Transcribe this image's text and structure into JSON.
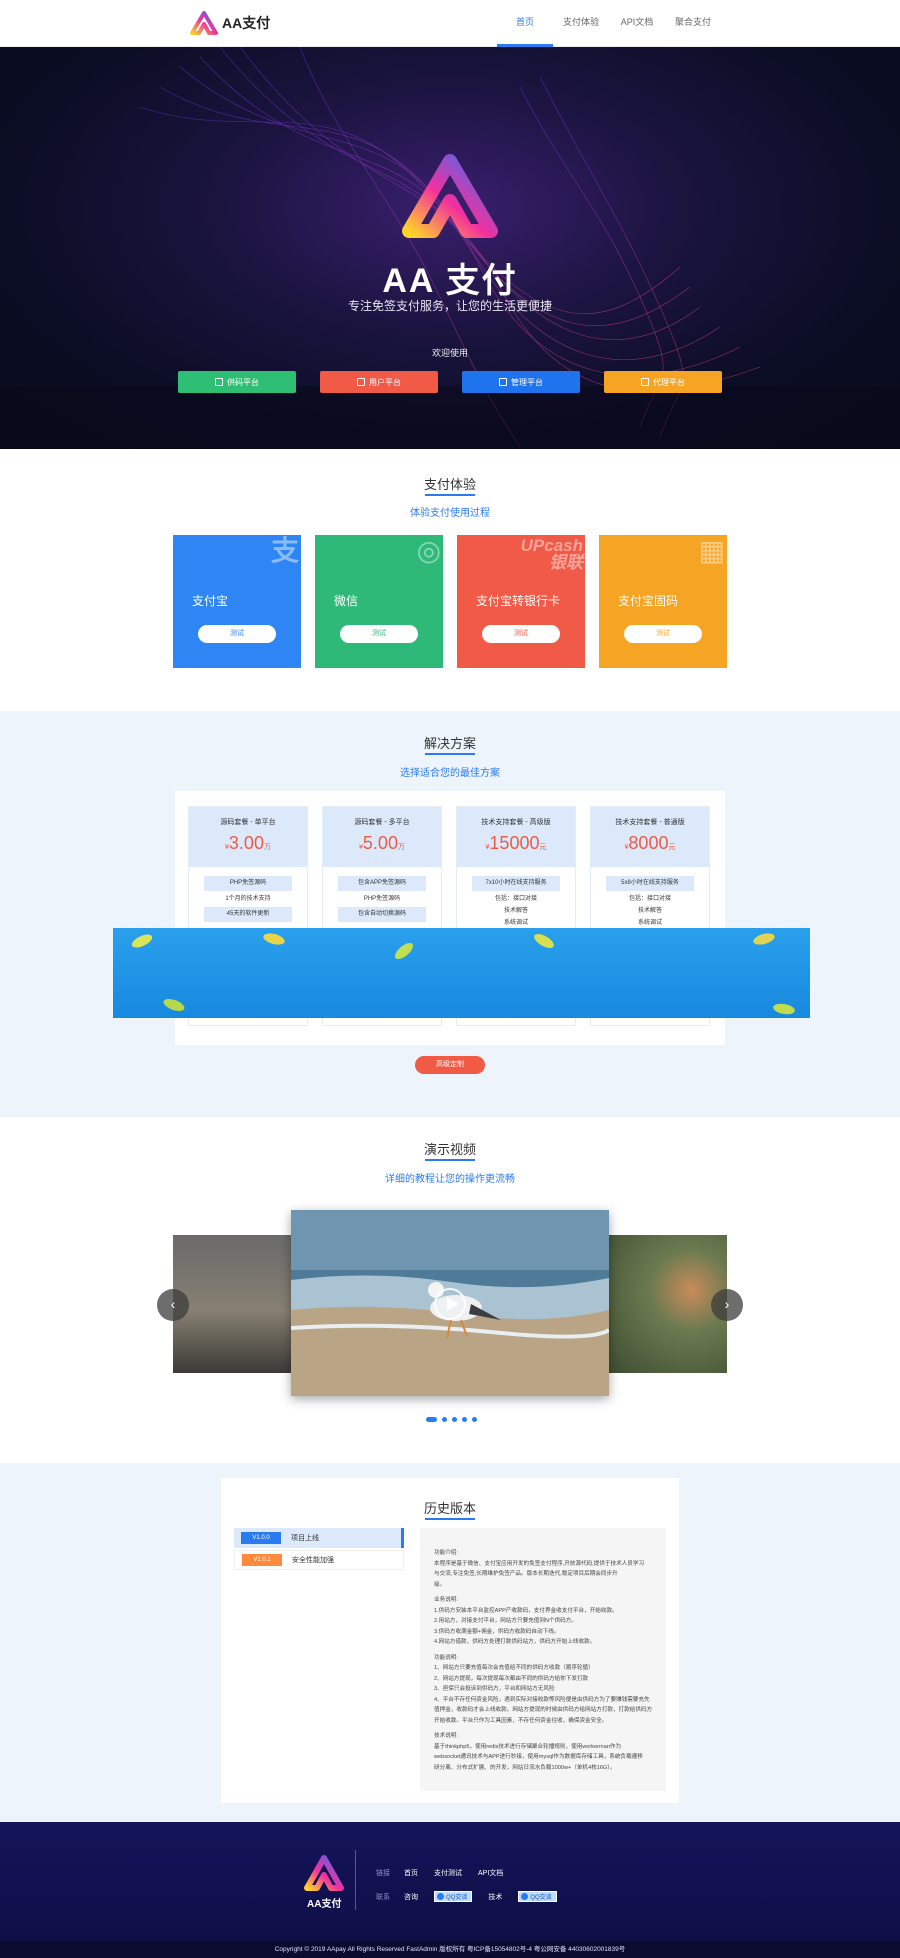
{
  "brand": {
    "name": "AA支付",
    "hero_title": "AA 支付",
    "tagline": "专注免签支付服务，让您的生活更便捷"
  },
  "nav": {
    "items": [
      "首页",
      "支付体验",
      "API文档",
      "聚合支付"
    ],
    "active": 0
  },
  "hero": {
    "welcome": "欢迎使用",
    "buttons": [
      {
        "label": "供码平台",
        "color": "#2fbf74",
        "icon": "store-icon"
      },
      {
        "label": "用户平台",
        "color": "#f05a47",
        "icon": "home-icon"
      },
      {
        "label": "管理平台",
        "color": "#1f74ee",
        "icon": "layers-icon"
      },
      {
        "label": "代理平台",
        "color": "#f5a423",
        "icon": "tag-icon"
      }
    ]
  },
  "pay_demo": {
    "title": "支付体验",
    "subtitle": "体验支付使用过程",
    "cards": [
      {
        "name": "支付宝",
        "button": "测试",
        "color": "#2e86f4",
        "icon": "alipay-icon"
      },
      {
        "name": "微信",
        "button": "测试",
        "color": "#2fb979",
        "icon": "wechat-icon"
      },
      {
        "name": "支付宝转银行卡",
        "button": "测试",
        "color": "#f05a47",
        "icon": "unionpay-icon",
        "deco_1": "UPcash",
        "deco_2": "银联"
      },
      {
        "name": "支付宝固码",
        "button": "测试",
        "color": "#f5a423",
        "icon": "qrcode-icon"
      }
    ]
  },
  "solutions": {
    "title": "解决方案",
    "subtitle": "选择适合您的最佳方案",
    "plans": [
      {
        "name": "源码套餐 - 单平台",
        "currency": "¥",
        "price": "3.00",
        "unit": "万",
        "features": [
          "PHP免签源码",
          "1个月的技术支持",
          "45天的软件更新"
        ]
      },
      {
        "name": "源码套餐 - 多平台",
        "currency": "¥",
        "price": "5.00",
        "unit": "万",
        "features": [
          "包含APP免签源码",
          "PHP免签源码",
          "包含自动切换源码"
        ]
      },
      {
        "name": "技术支持套餐 - 高级版",
        "currency": "¥",
        "price": "15000",
        "unit": "元",
        "features": [
          "7x10小时在线支持服务",
          "包括：接口对接",
          "技术解答",
          "系统调试"
        ]
      },
      {
        "name": "技术支持套餐 - 普通版",
        "currency": "¥",
        "price": "8000",
        "unit": "元",
        "features": [
          "5x8小时在线支持服务",
          "包括：接口对接",
          "技术解答",
          "系统调试"
        ]
      }
    ],
    "custom_button": "高级定制"
  },
  "video": {
    "title": "演示视频",
    "subtitle": "详细的教程让您的操作更流畅",
    "prev": "‹",
    "next": "›",
    "slides": 5,
    "active": 0
  },
  "history": {
    "title": "历史版本",
    "versions": [
      {
        "tag": "V1.0.0",
        "label": "项目上线",
        "color": "#2b7bf0"
      },
      {
        "tag": "V1.0.1",
        "label": "安全性能加强",
        "color": "#ff8a3d"
      }
    ],
    "log": [
      "功能介绍:",
      "本程序是基于微信、支付宝应用开发的免签支付程序,开放源代码,提供于技术人员学习",
      "与交流,专注免签,长期维护免签产品。版本长期迭代,稳定项目后期会同步升",
      "级。",
      "",
      "业务说明:",
      "1.供码方安装本平台监控APP产收款码，支付界金收支付平台，开始收款。",
      "2.用站方，对接支付平台，网站方只要充值到N个供码方。",
      "3.供码方收满金额+佣金，供码方收款码自动下线。",
      "4.网站方借款，供码方处理打款供码站方，供码方开始上线收款。",
      "",
      "功能说明:",
      "1、网站方只要充值每次会充值给不同的供码方收款（顺序轮循）",
      "2、网站方提现，每次提现每次都由不同的供码方给你下发打款",
      "3、担保只会投诉到供码方，平台和网站方无风险",
      "4、平台不存任何资金风险，遇到实际对接收款等风险便是由供码方为了要赚钱需要充先",
      "值押金，收款码才会上线收款。网站方提现的时候由供码方给网站方打款，打款给供码方",
      "开始收款。平台只作为工具因素，不存任何资金往收，确保资金安全。",
      "",
      "技术说明:",
      "基于thinkphp5，使用redis技术进行存储聚合轮播规则，使用workerman作为",
      "websocket通讯技术与APP进行秒接，使用mysql作为数据库存储工具，系统负载遵移",
      "研分离、分布式扩展、的开发，网站日流水负载1000w+（单机4核16G）。"
    ]
  },
  "footer": {
    "logo_text": "AA支付",
    "row1_label": "链接",
    "row1_links": [
      "首页",
      "支付测试",
      "API文档"
    ],
    "row2_label": "联系",
    "row2_items": [
      {
        "type": "text",
        "text": "咨询"
      },
      {
        "type": "qq",
        "text": "QQ交谈"
      },
      {
        "type": "text",
        "text": "技术"
      },
      {
        "type": "qq",
        "text": "QQ交谈"
      }
    ],
    "copyright": "Copyright © 2019 AApay All Rights Reserved FastAdmin 版权所有 粤ICP备15054802号-4 粤公网安备 44030602001839号"
  },
  "colors": {
    "accent": "#2b7bf0",
    "price": "#f15a45",
    "footer_bg": "#14145a"
  }
}
